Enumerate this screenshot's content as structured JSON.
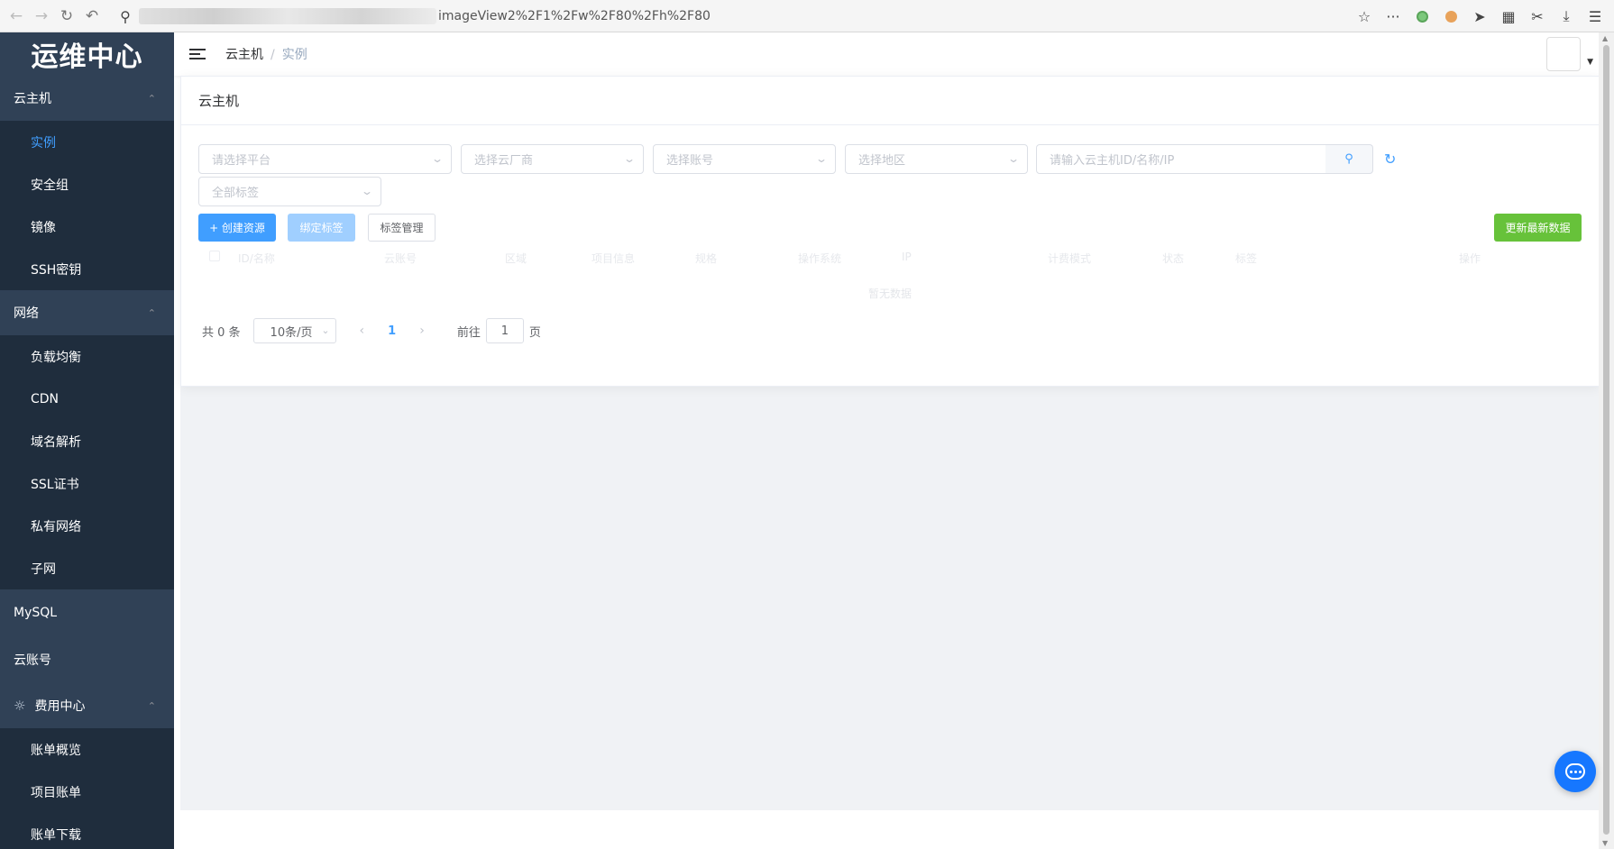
{
  "browser": {
    "url_visible": "imageView2%2F1%2Fw%2F80%2Fh%2F80",
    "icons": [
      "back-icon",
      "forward-icon",
      "reload-icon",
      "undo-icon",
      "search-icon",
      "star-icon",
      "more-icon",
      "extension-green-icon",
      "extension-orange-icon",
      "send-icon",
      "grid-icon",
      "scissors-icon",
      "download-icon",
      "menu-icon"
    ]
  },
  "sidebar": {
    "logo": "运维中心",
    "groups": [
      {
        "title": "云主机",
        "items": [
          "实例",
          "安全组",
          "镜像",
          "SSH密钥"
        ],
        "active": "实例"
      },
      {
        "title": "网络",
        "items": [
          "负载均衡",
          "CDN",
          "域名解析",
          "SSL证书",
          "私有网络",
          "子网"
        ]
      }
    ],
    "singles": [
      "MySQL",
      "云账号"
    ],
    "billing": {
      "title": "费用中心",
      "items": [
        "账单概览",
        "项目账单",
        "账单下载"
      ]
    }
  },
  "header": {
    "breadcrumb": [
      "云主机",
      "实例"
    ]
  },
  "card": {
    "title": "云主机",
    "filters": {
      "platform": "请选择平台",
      "vendor": "选择云厂商",
      "account": "选择账号",
      "region": "选择地区",
      "search": "请输入云主机ID/名称/IP",
      "tags": "全部标签"
    },
    "buttons": {
      "create": "+ 创建资源",
      "bind_tag": "绑定标签",
      "tag_manage": "标签管理",
      "refresh_data": "更新最新数据"
    },
    "columns": [
      "ID/名称",
      "云账号",
      "区域",
      "项目信息",
      "规格",
      "操作系统",
      "IP",
      "计费模式",
      "状态",
      "标签",
      "操作"
    ],
    "empty_text": "暂无数据",
    "pagination": {
      "total": "共 0 条",
      "page_size": "10条/页",
      "current": "1",
      "goto_label": "前往",
      "goto_value": "1",
      "page_suffix": "页"
    }
  }
}
